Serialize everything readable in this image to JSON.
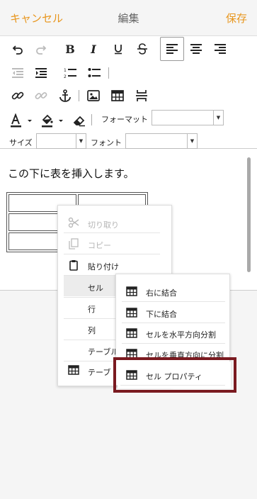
{
  "header": {
    "cancel": "キャンセル",
    "title": "編集",
    "save": "保存"
  },
  "toolbar": {
    "bold": "B",
    "italic": "I",
    "format_label": "フォーマット",
    "size_label": "サイズ",
    "font_label": "フォント",
    "format_value": "",
    "size_value": "",
    "font_value": ""
  },
  "editor": {
    "paragraph": "この下に表を挿入します。",
    "table": [
      [
        "",
        ""
      ],
      [
        "",
        ""
      ],
      [
        "",
        ""
      ]
    ]
  },
  "context_menu": {
    "items": [
      {
        "label": "切り取り",
        "icon": "scissors-icon",
        "enabled": false
      },
      {
        "label": "コピー",
        "icon": "copy-icon",
        "enabled": false
      },
      {
        "label": "貼り付け",
        "icon": "clipboard-icon",
        "enabled": true
      },
      {
        "label": "セル",
        "icon": "",
        "enabled": true,
        "highlighted": true
      },
      {
        "label": "行",
        "icon": "",
        "enabled": true
      },
      {
        "label": "列",
        "icon": "",
        "enabled": true
      },
      {
        "label": "テーブル",
        "icon": "",
        "enabled": true
      },
      {
        "label": "テーブ",
        "icon": "table-icon",
        "enabled": true
      }
    ]
  },
  "cell_submenu": {
    "items": [
      {
        "label": "右に結合",
        "icon": "table-icon"
      },
      {
        "label": "下に結合",
        "icon": "table-icon"
      },
      {
        "label": "セルを水平方向分割",
        "icon": "table-icon"
      },
      {
        "label": "セルを垂直方向に分割",
        "icon": "table-icon"
      },
      {
        "label": "セル プロパティ",
        "icon": "table-icon"
      }
    ]
  },
  "colors": {
    "accent": "#e8961e",
    "highlight_box": "#7a1a20"
  }
}
